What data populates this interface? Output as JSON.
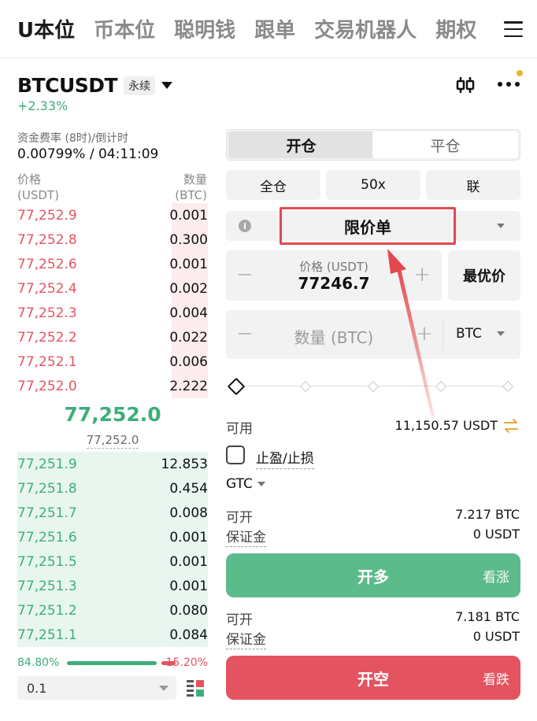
{
  "nav": {
    "tabs": [
      {
        "label": "U本位",
        "active": true
      },
      {
        "label": "币本位",
        "active": false
      },
      {
        "label": "聪明钱",
        "active": false
      },
      {
        "label": "跟单",
        "active": false
      },
      {
        "label": "交易机器人",
        "active": false
      },
      {
        "label": "期权",
        "active": false
      }
    ],
    "menu_icon": "hamburger-menu-icon"
  },
  "symbol": {
    "name": "BTCUSDT",
    "tag": "永续",
    "change": "+2.33%",
    "change_color": "#3dae79"
  },
  "funding": {
    "label": "资金费率 (8时)/倒计时",
    "value": "0.00799% / 04:11:09"
  },
  "orderbook": {
    "price_header": "价格",
    "price_unit": "(USDT)",
    "qty_header": "数量",
    "qty_unit": "(BTC)",
    "asks": [
      {
        "price": "77,252.9",
        "qty": "0.001",
        "depth": 0.19
      },
      {
        "price": "77,252.8",
        "qty": "0.300",
        "depth": 0.19
      },
      {
        "price": "77,252.6",
        "qty": "0.001",
        "depth": 0.19
      },
      {
        "price": "77,252.4",
        "qty": "0.002",
        "depth": 0.19
      },
      {
        "price": "77,252.3",
        "qty": "0.004",
        "depth": 0.19
      },
      {
        "price": "77,252.2",
        "qty": "0.022",
        "depth": 0.19
      },
      {
        "price": "77,252.1",
        "qty": "0.006",
        "depth": 0.19
      },
      {
        "price": "77,252.0",
        "qty": "2.222",
        "depth": 0.19
      }
    ],
    "last_price": "77,252.0",
    "mark_price": "77,252.0",
    "bids": [
      {
        "price": "77,251.9",
        "qty": "12.853",
        "depth": 1.0
      },
      {
        "price": "77,251.8",
        "qty": "0.454",
        "depth": 1.0
      },
      {
        "price": "77,251.7",
        "qty": "0.008",
        "depth": 1.0
      },
      {
        "price": "77,251.6",
        "qty": "0.001",
        "depth": 1.0
      },
      {
        "price": "77,251.5",
        "qty": "0.001",
        "depth": 1.0
      },
      {
        "price": "77,251.3",
        "qty": "0.001",
        "depth": 1.0
      },
      {
        "price": "77,251.2",
        "qty": "0.080",
        "depth": 1.0
      },
      {
        "price": "77,251.1",
        "qty": "0.084",
        "depth": 1.0
      }
    ],
    "buy_ratio": "84.80%",
    "sell_ratio": "15.20%",
    "buy_fraction": 0.848,
    "precision": "0.1"
  },
  "order_form": {
    "open_tab": "开仓",
    "close_tab": "平仓",
    "margin_mode": "全仓",
    "leverage": "50x",
    "position_mode": "联",
    "order_type": "限价单",
    "price_label": "价格 (USDT)",
    "price_value": "77246.7",
    "best_price": "最优价",
    "qty_placeholder": "数量 (BTC)",
    "qty_unit": "BTC",
    "available_label": "可用",
    "available_value": "11,150.57 USDT",
    "tpsl_label": "止盈/止损",
    "tif": "GTC",
    "long_max_label": "可开",
    "long_max_value": "7.217 BTC",
    "long_margin_label": "保证金",
    "long_margin_value": "0 USDT",
    "buy_button": "开多",
    "buy_sub": "看涨",
    "short_max_label": "可开",
    "short_max_value": "7.181 BTC",
    "short_margin_label": "保证金",
    "short_margin_value": "0 USDT",
    "sell_button": "开空",
    "sell_sub": "看跌"
  },
  "colors": {
    "green": "#3dae79",
    "red": "#e35460",
    "buy_button": "#5cbb8b",
    "annotation": "#e4484f"
  }
}
